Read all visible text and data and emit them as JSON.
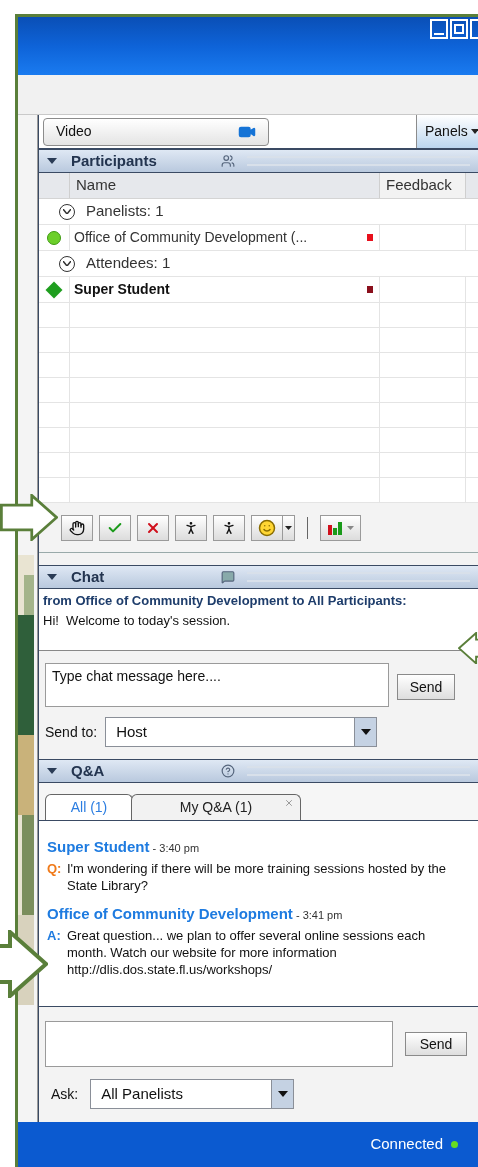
{
  "video_button": {
    "label": "Video"
  },
  "panels_menu": {
    "label": "Panels"
  },
  "participants": {
    "title": "Participants",
    "columns": [
      "Name",
      "Feedback"
    ],
    "rows": [
      {
        "kind": "group",
        "label": "Panelists: 1",
        "expanded": true
      },
      {
        "kind": "panelist",
        "name": "Office of Community Development (...",
        "is_me": false,
        "color": "#e8101c"
      },
      {
        "kind": "group",
        "label": "Attendees: 1",
        "expanded": true
      },
      {
        "kind": "attendee",
        "name": "Super Student",
        "is_me": true,
        "color": "#8a0f1c"
      }
    ]
  },
  "chat": {
    "title": "Chat",
    "messages": [
      {
        "header": "from Office of Community Development to All Participants:",
        "text": "Hi!  Welcome to today's session."
      }
    ],
    "input": {
      "placeholder": "Type chat message here...."
    },
    "send_button": {
      "label": "Send"
    },
    "send_to": {
      "label": "Send to:",
      "value": "Host"
    }
  },
  "qa": {
    "title": "Q&A",
    "tabs": [
      {
        "label": "All (1)",
        "selected": true,
        "closable": false
      },
      {
        "label": "My Q&A (1)",
        "selected": false,
        "closable": true
      }
    ],
    "entries": [
      {
        "kind": "question",
        "author": "Super Student",
        "time": "- 3:40 pm",
        "marker": "Q:",
        "text": "I'm wondering if there will be more training sessions hosted by the State Library?"
      },
      {
        "kind": "answer",
        "author": "Office of Community Development",
        "time": "- 3:41 pm",
        "marker": "A:",
        "text": "Great question... we plan to offer several online sessions each month.  Watch our website for more information http://dlis.dos.state.fl.us/workshops/"
      }
    ],
    "send_button": {
      "label": "Send"
    },
    "ask": {
      "label": "Ask:",
      "value": "All Panelists"
    }
  },
  "status_bar": {
    "text": "Connected",
    "connected": true
  }
}
